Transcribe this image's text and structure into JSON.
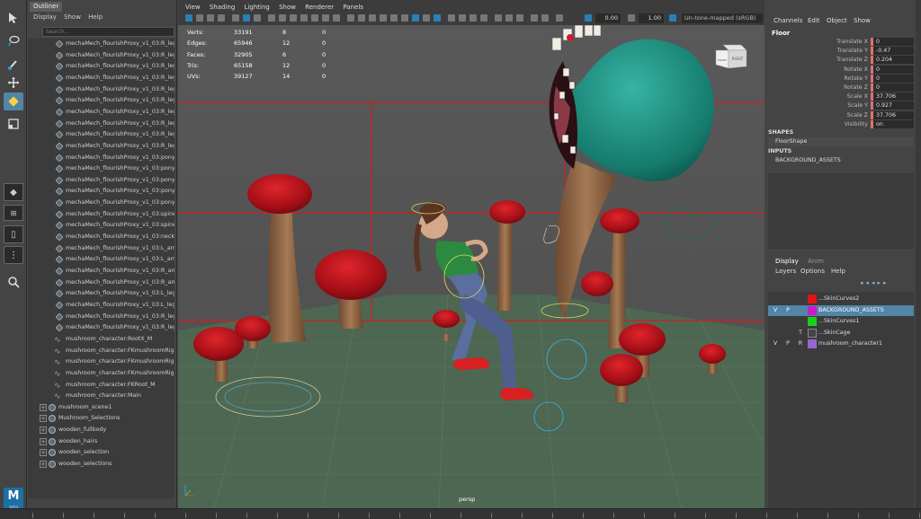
{
  "outliner": {
    "title": "Outliner",
    "menu": [
      "Display",
      "Show",
      "Help"
    ],
    "search_placeholder": "Search...",
    "items": [
      {
        "label": "mechaMech_flourishProxy_v1_03:R_leg",
        "kind": "mesh",
        "indent": 2
      },
      {
        "label": "mechaMech_flourishProxy_v1_03:R_leg",
        "kind": "mesh",
        "indent": 2
      },
      {
        "label": "mechaMech_flourishProxy_v1_03:R_leg",
        "kind": "mesh",
        "indent": 2
      },
      {
        "label": "mechaMech_flourishProxy_v1_03:R_leg",
        "kind": "mesh",
        "indent": 2
      },
      {
        "label": "mechaMech_flourishProxy_v1_03:R_leg",
        "kind": "mesh",
        "indent": 2
      },
      {
        "label": "mechaMech_flourishProxy_v1_03:R_leg",
        "kind": "mesh",
        "indent": 2
      },
      {
        "label": "mechaMech_flourishProxy_v1_03:R_leg",
        "kind": "mesh",
        "indent": 2
      },
      {
        "label": "mechaMech_flourishProxy_v1_03:R_leg",
        "kind": "mesh",
        "indent": 2
      },
      {
        "label": "mechaMech_flourishProxy_v1_03:R_leg",
        "kind": "mesh",
        "indent": 2
      },
      {
        "label": "mechaMech_flourishProxy_v1_03:R_leg",
        "kind": "mesh",
        "indent": 2
      },
      {
        "label": "mechaMech_flourishProxy_v1_03:pony",
        "kind": "mesh",
        "indent": 2
      },
      {
        "label": "mechaMech_flourishProxy_v1_03:pony",
        "kind": "mesh",
        "indent": 2
      },
      {
        "label": "mechaMech_flourishProxy_v1_03:pony",
        "kind": "mesh",
        "indent": 2
      },
      {
        "label": "mechaMech_flourishProxy_v1_03:pony",
        "kind": "mesh",
        "indent": 2
      },
      {
        "label": "mechaMech_flourishProxy_v1_03:pony",
        "kind": "mesh",
        "indent": 2
      },
      {
        "label": "mechaMech_flourishProxy_v1_03:spine",
        "kind": "mesh",
        "indent": 2
      },
      {
        "label": "mechaMech_flourishProxy_v1_03:spine",
        "kind": "mesh",
        "indent": 2
      },
      {
        "label": "mechaMech_flourishProxy_v1_03:neck",
        "kind": "mesh",
        "indent": 2
      },
      {
        "label": "mechaMech_flourishProxy_v1_03:L_arr",
        "kind": "mesh",
        "indent": 2
      },
      {
        "label": "mechaMech_flourishProxy_v1_03:L_arr",
        "kind": "mesh",
        "indent": 2
      },
      {
        "label": "mechaMech_flourishProxy_v1_03:R_arr",
        "kind": "mesh",
        "indent": 2
      },
      {
        "label": "mechaMech_flourishProxy_v1_03:R_arr",
        "kind": "mesh",
        "indent": 2
      },
      {
        "label": "mechaMech_flourishProxy_v1_03:L_leg",
        "kind": "mesh",
        "indent": 2
      },
      {
        "label": "mechaMech_flourishProxy_v1_03:L_leg",
        "kind": "mesh",
        "indent": 2
      },
      {
        "label": "mechaMech_flourishProxy_v1_03:R_leg",
        "kind": "mesh",
        "indent": 2
      },
      {
        "label": "mechaMech_flourishProxy_v1_03:R_leg",
        "kind": "mesh",
        "indent": 2
      },
      {
        "label": "mushroom_character:RootX_M",
        "kind": "curve",
        "indent": 1
      },
      {
        "label": "mushroom_character:FKmushroomRig",
        "kind": "curve",
        "indent": 1
      },
      {
        "label": "mushroom_character:FKmushroomRig",
        "kind": "curve",
        "indent": 1
      },
      {
        "label": "mushroom_character:FKmushroomRig",
        "kind": "curve",
        "indent": 1
      },
      {
        "label": "mushroom_character:FKRoot_M",
        "kind": "curve",
        "indent": 1
      },
      {
        "label": "mushroom_character:Main",
        "kind": "curve",
        "indent": 1
      },
      {
        "label": "mushroom_scene1",
        "kind": "group",
        "indent": 0
      },
      {
        "label": "Mushroom_Selections",
        "kind": "group",
        "indent": 0
      },
      {
        "label": "wooden_fullbody",
        "kind": "group",
        "indent": 0
      },
      {
        "label": "wooden_hairs",
        "kind": "group",
        "indent": 0
      },
      {
        "label": "wooden_selection",
        "kind": "group",
        "indent": 0
      },
      {
        "label": "wooden_selections",
        "kind": "group",
        "indent": 0
      }
    ]
  },
  "viewport": {
    "menu": [
      "View",
      "Shading",
      "Lighting",
      "Show",
      "Renderer",
      "Panels"
    ],
    "field_a": "0.00",
    "field_b": "1.00",
    "colorspace": "Un-tone-mapped (sRGB)",
    "camera_label": "persp",
    "viewcube": {
      "top": "TOP",
      "front": "FRONT",
      "right": "RIGHT"
    },
    "hud": [
      {
        "name": "Verts:",
        "a": "33191",
        "b": "8",
        "c": "0"
      },
      {
        "name": "Edges:",
        "a": "65946",
        "b": "12",
        "c": "0"
      },
      {
        "name": "Faces:",
        "a": "32905",
        "b": "6",
        "c": "0"
      },
      {
        "name": "Tris:",
        "a": "65158",
        "b": "12",
        "c": "0"
      },
      {
        "name": "UVs:",
        "a": "39127",
        "b": "14",
        "c": "0"
      }
    ]
  },
  "channel_box": {
    "menu": [
      "Channels",
      "Edit",
      "Object",
      "Show"
    ],
    "object": "Floor",
    "attributes": [
      {
        "name": "Translate X",
        "value": "0"
      },
      {
        "name": "Translate Y",
        "value": "-0.47"
      },
      {
        "name": "Translate Z",
        "value": "0.204"
      },
      {
        "name": "Rotate X",
        "value": "0"
      },
      {
        "name": "Rotate Y",
        "value": "0"
      },
      {
        "name": "Rotate Z",
        "value": "0"
      },
      {
        "name": "Scale X",
        "value": "37.706"
      },
      {
        "name": "Scale Y",
        "value": "0.927"
      },
      {
        "name": "Scale Z",
        "value": "37.706"
      },
      {
        "name": "Visibility",
        "value": "on"
      }
    ],
    "shapes_label": "SHAPES",
    "shape_name": "FloorShape",
    "inputs_label": "INPUTS",
    "input_name": "BACKGROUND_ASSETS"
  },
  "layer_editor": {
    "tabs": [
      "Display",
      "Anim"
    ],
    "menu": [
      "Layers",
      "Options",
      "Help"
    ],
    "layers": [
      {
        "v": "",
        "p": "",
        "r": "",
        "name": "...SkinCurves2",
        "color": "#e01414",
        "selected": false
      },
      {
        "v": "V",
        "p": "P",
        "r": "",
        "name": "BACKGROUND_ASSETS",
        "color": "#d018d0",
        "selected": true
      },
      {
        "v": "",
        "p": "",
        "r": "",
        "name": "...SkinCurves1",
        "color": "#18d018",
        "selected": false
      },
      {
        "v": "",
        "p": "",
        "r": "T",
        "name": "...SkinCage",
        "color": "#444444",
        "selected": false
      },
      {
        "v": "V",
        "p": "P",
        "r": "R",
        "name": "mushroom_character1",
        "color": "#9966cc",
        "selected": false
      }
    ]
  },
  "app": {
    "logo_letter": "M",
    "logo_sub": "2023"
  },
  "icons": [
    "select-arrow-icon",
    "lasso-icon",
    "paint-select-icon",
    "move-icon",
    "rotate-icon",
    "scale-icon",
    "layout-icon",
    "search-icon"
  ]
}
